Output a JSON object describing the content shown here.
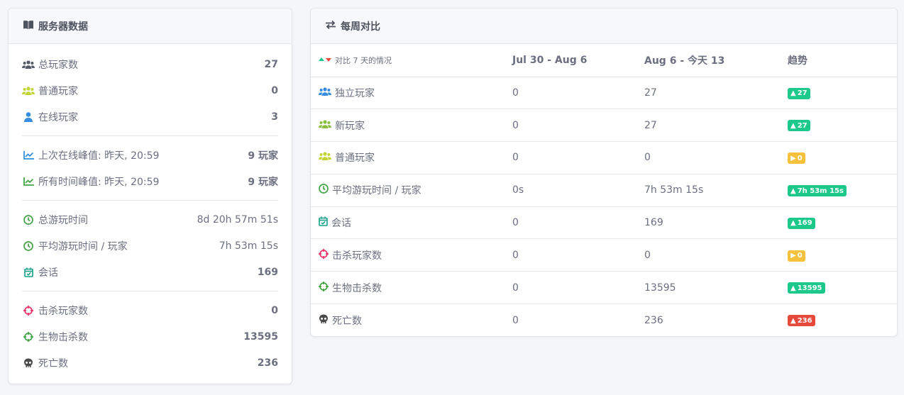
{
  "server_card": {
    "title": "服务器数据",
    "rows": [
      {
        "icon": "users-icon",
        "label": "总玩家数",
        "value": "27",
        "bold": true
      },
      {
        "icon": "users-icon",
        "label": "普通玩家",
        "value": "0",
        "bold": true
      },
      {
        "icon": "user-icon",
        "label": "在线玩家",
        "value": "3",
        "bold": true
      },
      {
        "icon": "chart-line-icon",
        "label": "上次在线峰值: 昨天, 20:59",
        "value": "9 玩家",
        "bold": true
      },
      {
        "icon": "chart-line-icon",
        "label": "所有时间峰值: 昨天, 20:59",
        "value": "9 玩家",
        "bold": true
      },
      {
        "icon": "clock-icon",
        "label": "总游玩时间",
        "value": "8d 20h 57m 51s",
        "bold": false
      },
      {
        "icon": "clock-icon",
        "label": "平均游玩时间 / 玩家",
        "value": "7h 53m 15s",
        "bold": false
      },
      {
        "icon": "calendar-check-icon",
        "label": "会话",
        "value": "169",
        "bold": true
      },
      {
        "icon": "crosshairs-icon",
        "label": "击杀玩家数",
        "value": "0",
        "bold": true
      },
      {
        "icon": "crosshairs-icon",
        "label": "生物击杀数",
        "value": "13595",
        "bold": true
      },
      {
        "icon": "skull-icon",
        "label": "死亡数",
        "value": "236",
        "bold": true
      }
    ]
  },
  "weekly_card": {
    "title": "每周对比",
    "columns": [
      "对比 7 天的情况",
      "Jul 30 - Aug 6",
      "Aug 6 - 今天 13",
      "趋势"
    ],
    "rows": [
      {
        "icon": "users-icon",
        "label": "独立玩家",
        "before": "0",
        "after": "27",
        "trend": "27",
        "trend_type": "up"
      },
      {
        "icon": "users-icon",
        "label": "新玩家",
        "before": "0",
        "after": "27",
        "trend": "27",
        "trend_type": "up"
      },
      {
        "icon": "users-icon",
        "label": "普通玩家",
        "before": "0",
        "after": "0",
        "trend": "0",
        "trend_type": "neutral"
      },
      {
        "icon": "clock-icon",
        "label": "平均游玩时间 / 玩家",
        "before": "0s",
        "after": "7h 53m 15s",
        "trend": "7h 53m 15s",
        "trend_type": "up"
      },
      {
        "icon": "calendar-check-icon",
        "label": "会话",
        "before": "0",
        "after": "169",
        "trend": "169",
        "trend_type": "up"
      },
      {
        "icon": "crosshairs-icon",
        "label": "击杀玩家数",
        "before": "0",
        "after": "0",
        "trend": "0",
        "trend_type": "neutral"
      },
      {
        "icon": "crosshairs-icon",
        "label": "生物击杀数",
        "before": "0",
        "after": "13595",
        "trend": "13595",
        "trend_type": "up"
      },
      {
        "icon": "skull-icon",
        "label": "死亡数",
        "before": "0",
        "after": "236",
        "trend": "236",
        "trend_type": "down"
      }
    ]
  },
  "colors": {
    "blue": "#368ee0",
    "green": "#8cbf3f",
    "yellow_green": "#c4d435",
    "teal": "#17a08a",
    "pink": "#e8356b",
    "dark": "#4a4a4a",
    "badge_up": "#1cc88a",
    "badge_neutral": "#f6c23e",
    "badge_down": "#e74a3b"
  }
}
